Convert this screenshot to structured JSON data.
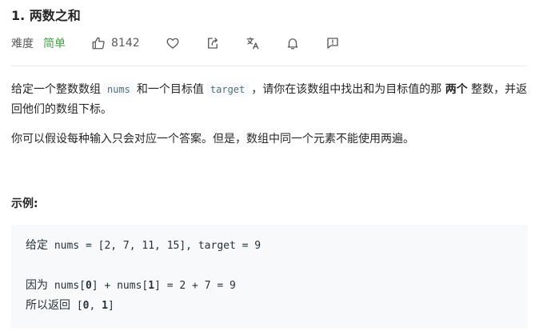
{
  "problem": {
    "title": "1. 两数之和",
    "difficulty_label": "难度",
    "difficulty_value": "简单",
    "likes": "8142",
    "colors": {
      "difficulty": "#43a047",
      "code_text": "#546e7a",
      "code_bg": "#f7f9fa"
    }
  },
  "actions": {
    "like_icon": "thumbs-up-icon",
    "favorite_icon": "heart-icon",
    "share_icon": "share-icon",
    "translate_icon": "translate-icon",
    "notify_icon": "bell-icon",
    "feedback_icon": "feedback-icon"
  },
  "description": {
    "p1_a": "给定一个整数数组",
    "p1_code1": "nums",
    "p1_b": "和一个目标值",
    "p1_code2": "target",
    "p1_c": "，请你在该数组中找出和为目标值的那",
    "p1_bold": "两个",
    "p1_d": "整数，并返回他们的数组下标。",
    "p2": "你可以假设每种输入只会对应一个答案。但是，数组中同一个元素不能使用两遍。"
  },
  "example": {
    "heading": "示例:",
    "line1_label": "给定",
    "line1_code": " nums = [2, 7, 11, 15], target = 9",
    "line2_label": "因为",
    "line2_code_a": " nums[",
    "line2_code_b": "0",
    "line2_code_c": "] + nums[",
    "line2_code_d": "1",
    "line2_code_e": "] = 2 + 7 = 9",
    "line3_label": "所以返回",
    "line3_code_a": " [",
    "line3_code_b": "0",
    "line3_code_c": ", ",
    "line3_code_d": "1",
    "line3_code_e": "]"
  }
}
